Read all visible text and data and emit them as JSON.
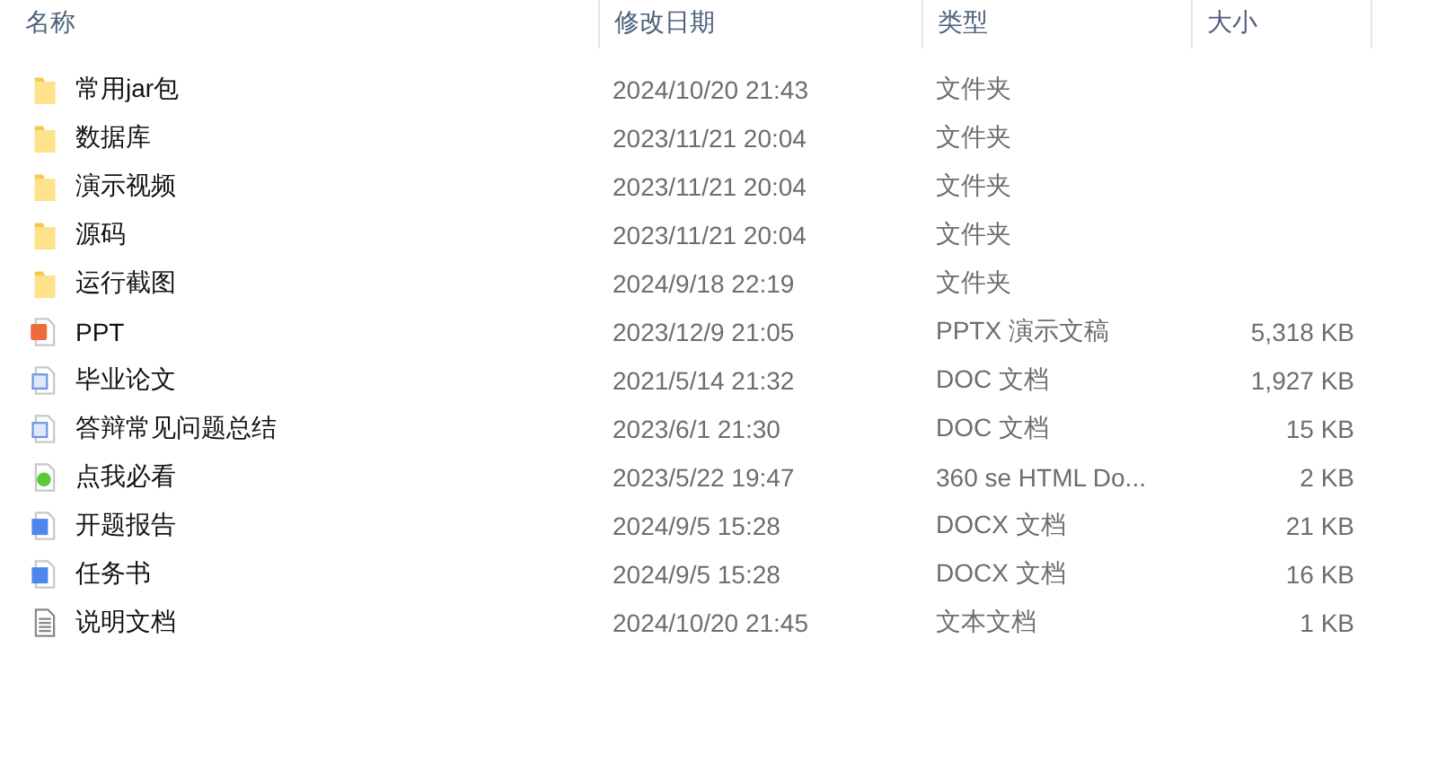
{
  "columns": [
    "名称",
    "修改日期",
    "类型",
    "大小"
  ],
  "rows": [
    {
      "kind": "folder",
      "name": "常用jar包",
      "date": "2024/10/20 21:43",
      "type": "文件夹"
    },
    {
      "kind": "folder",
      "name": "数据库",
      "date": "2023/11/21 20:04",
      "type": "文件夹"
    },
    {
      "kind": "folder",
      "name": "演示视频",
      "date": "2023/11/21 20:04",
      "type": "文件夹"
    },
    {
      "kind": "folder",
      "name": "源码",
      "date": "2023/11/21 20:04",
      "type": "文件夹"
    },
    {
      "kind": "folder",
      "name": "运行截图",
      "date": "2024/9/18 22:19",
      "type": "文件夹"
    },
    {
      "kind": "pptx",
      "name": "PPT",
      "date": "2023/12/9 21:05",
      "type": "PPTX 演示文稿",
      "size": "5,318 KB"
    },
    {
      "kind": "doc",
      "name": "毕业论文",
      "date": "2021/5/14 21:32",
      "type": "DOC 文档",
      "size": "1,927 KB"
    },
    {
      "kind": "doc",
      "name": "答辩常见问题总结",
      "date": "2023/6/1 21:30",
      "type": "DOC 文档",
      "size": "15 KB"
    },
    {
      "kind": "html",
      "name": "点我必看",
      "date": "2023/5/22 19:47",
      "type": "360 se HTML Do...",
      "size": "2 KB"
    },
    {
      "kind": "docx",
      "name": "开题报告",
      "date": "2024/9/5 15:28",
      "type": "DOCX 文档",
      "size": "21 KB"
    },
    {
      "kind": "docx",
      "name": "任务书",
      "date": "2024/9/5 15:28",
      "type": "DOCX 文档",
      "size": "16 KB"
    },
    {
      "kind": "txt",
      "name": "说明文档",
      "date": "2024/10/20 21:45",
      "type": "文本文档",
      "size": "1 KB"
    }
  ]
}
